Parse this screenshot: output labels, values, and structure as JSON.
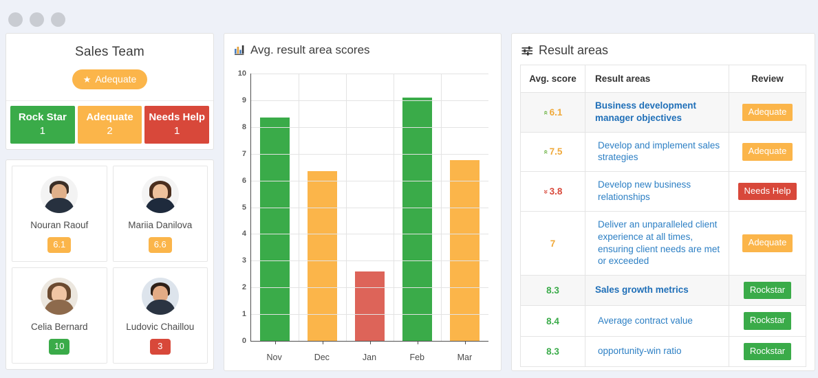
{
  "window": {
    "dots": [
      "dot-1",
      "dot-2",
      "dot-3"
    ]
  },
  "team": {
    "title": "Sales Team",
    "overall_badge": {
      "label": "Adequate",
      "icon": "star-icon",
      "color": "#fbb54a"
    },
    "categories": [
      {
        "label": "Rock Star",
        "count": "1",
        "color": "#3aab49"
      },
      {
        "label": "Adequate",
        "count": "2",
        "color": "#fbb54a"
      },
      {
        "label": "Needs Help",
        "count": "1",
        "color": "#d8483a"
      }
    ],
    "members": [
      {
        "name": "Nouran Raouf",
        "score": "6.1",
        "level": "orange"
      },
      {
        "name": "Mariia Danilova",
        "score": "6.6",
        "level": "orange"
      },
      {
        "name": "Celia Bernard",
        "score": "10",
        "level": "green"
      },
      {
        "name": "Ludovic Chaillou",
        "score": "3",
        "level": "red"
      }
    ]
  },
  "chart_panel": {
    "title": "Avg. result area scores",
    "icon": "bar-chart-icon"
  },
  "chart_data": {
    "type": "bar",
    "title": "Avg. result area scores",
    "categories": [
      "Nov",
      "Dec",
      "Jan",
      "Feb",
      "Mar"
    ],
    "values": [
      8.35,
      6.35,
      2.6,
      9.1,
      6.75
    ],
    "colors": [
      "#3aab49",
      "#fbb54a",
      "#dd6459",
      "#3aab49",
      "#fbb54a"
    ],
    "ylim": [
      0,
      10
    ],
    "yticks": [
      "10",
      "9",
      "8",
      "7",
      "6",
      "5",
      "4",
      "3",
      "2",
      "1",
      "0"
    ],
    "xlabel": "",
    "ylabel": "",
    "grid": true,
    "legend": "none"
  },
  "result_areas": {
    "title": "Result areas",
    "icon": "sliders-icon",
    "columns": [
      "Avg. score",
      "Result areas",
      "Review"
    ],
    "rows": [
      {
        "score": "6.1",
        "trend": "up",
        "score_color": "orange",
        "area": "Business development manager objectives",
        "bold": true,
        "indent": false,
        "review": "Adequate",
        "review_color": "orange",
        "shaded": true
      },
      {
        "score": "7.5",
        "trend": "up",
        "score_color": "orange",
        "area": "Develop and implement sales strategies",
        "bold": false,
        "indent": true,
        "review": "Adequate",
        "review_color": "orange",
        "shaded": false
      },
      {
        "score": "3.8",
        "trend": "down",
        "score_color": "red",
        "area": "Develop new business relationships",
        "bold": false,
        "indent": true,
        "review": "Needs Help",
        "review_color": "red",
        "shaded": false
      },
      {
        "score": "7",
        "trend": "none",
        "score_color": "orange",
        "area": "Deliver an unparalleled client experience at all times, ensuring client needs are met or exceeded",
        "bold": false,
        "indent": true,
        "review": "Adequate",
        "review_color": "orange",
        "shaded": false
      },
      {
        "score": "8.3",
        "trend": "none",
        "score_color": "green",
        "area": "Sales growth metrics",
        "bold": true,
        "indent": false,
        "review": "Rockstar",
        "review_color": "green",
        "shaded": true
      },
      {
        "score": "8.4",
        "trend": "none",
        "score_color": "green",
        "area": "Average contract value",
        "bold": false,
        "indent": true,
        "review": "Rockstar",
        "review_color": "green",
        "shaded": false
      },
      {
        "score": "8.3",
        "trend": "none",
        "score_color": "green",
        "area": "opportunity-win ratio",
        "bold": false,
        "indent": true,
        "review": "Rockstar",
        "review_color": "green",
        "shaded": false
      }
    ]
  }
}
